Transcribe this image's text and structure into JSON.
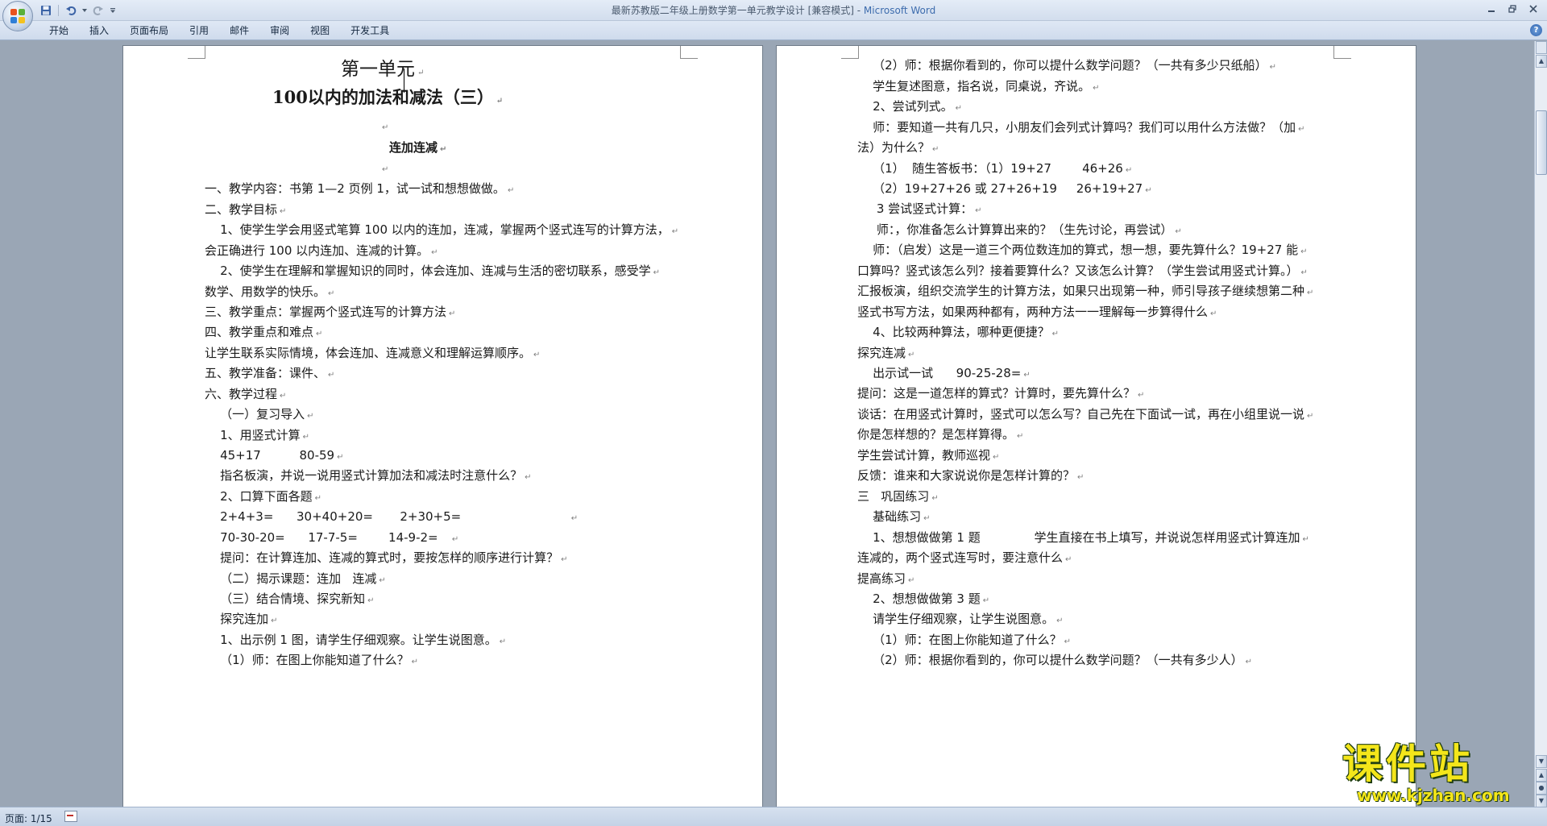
{
  "window": {
    "title": "最新苏教版二年级上册数学第一单元教学设计 [兼容模式] - ",
    "app_name": "Microsoft Word"
  },
  "ribbon": {
    "tabs": [
      "开始",
      "插入",
      "页面布局",
      "引用",
      "邮件",
      "审阅",
      "视图",
      "开发工具"
    ]
  },
  "icons": {
    "office_button": "office-logo-icon",
    "save": "save-icon",
    "undo": "undo-icon",
    "redo": "redo-icon",
    "customize": "qat-dropdown-icon",
    "minimize": "minimize-icon",
    "maximize": "restore-icon",
    "close": "close-icon",
    "help": "help-icon"
  },
  "colors": {
    "office_logo": [
      "#e8531f",
      "#5ab03a",
      "#2f7fd6",
      "#f4c21f"
    ],
    "watermark_fill": "#f4e61a",
    "watermark_outline": "#1f3d12"
  },
  "page_left": {
    "paragraphs": [
      "第一单元",
      "100以内的加法和减法（三）",
      "",
      "连加连减",
      "",
      "一、教学内容：书第 1—2 页例 1，试一试和想想做做。",
      "二、教学目标",
      "    1、使学生学会用竖式笔算 100 以内的连加，连减，掌握两个竖式连写的计算方法，",
      "会正确进行 100 以内连加、连减的计算。",
      "    2、使学生在理解和掌握知识的同时，体会连加、连减与生活的密切联系，感受学",
      "数学、用数学的快乐。",
      "三、教学重点：掌握两个竖式连写的计算方法",
      "四、教学重点和难点",
      "让学生联系实际情境，体会连加、连减意义和理解运算顺序。",
      "五、教学准备：课件、",
      "六、教学过程",
      "    （一）复习导入",
      "    1、用竖式计算",
      "    45+17          80-59",
      "    指名板演，并说一说用竖式计算加法和减法时注意什么？",
      "    2、口算下面各题",
      "    2+4+3=      30+40+20=       2+30+5=                            ",
      "    70-30-20=      17-7-5=        14-9-2=   ",
      "    提问：在计算连加、连减的算式时，要按怎样的顺序进行计算？",
      "    （二）揭示课题：连加   连减",
      "    （三）结合情境、探究新知",
      "    探究连加",
      "    1、出示例 1 图，请学生仔细观察。让学生说图意。",
      "    （1）师：在图上你能知道了什么？"
    ]
  },
  "page_right": {
    "paragraphs": [
      "    （2）师：根据你看到的，你可以提什么数学问题？（一共有多少只纸船）",
      "    学生复述图意，指名说，同桌说，齐说。",
      "    2、尝试列式。",
      "    师：要知道一共有几只，小朋友们会列式计算吗？我们可以用什么方法做？（加",
      "法）为什么？",
      "    （1）  随生答板书：（1）19+27        46+26",
      "    （2）19+27+26 或 27+26+19     26+19+27",
      "     3 尝试竖式计算：",
      "     师：，你准备怎么计算算出来的？（生先讨论，再尝试）",
      "    师：（启发）这是一道三个两位数连加的算式，想一想，要先算什么？19+27 能",
      "口算吗？竖式该怎么列？接着要算什么？又该怎么计算？（学生尝试用竖式计算。）",
      "汇报板演，组织交流学生的计算方法，如果只出现第一种，师引导孩子继续想第二种",
      "竖式书写方法，如果两种都有，两种方法一一理解每一步算得什么",
      "    4、比较两种算法，哪种更便捷？",
      "探究连减",
      "    出示试一试      90-25-28=",
      "提问：这是一道怎样的算式？计算时，要先算什么？",
      "谈话：在用竖式计算时，竖式可以怎么写？自己先在下面试一试，再在小组里说一说",
      "你是怎样想的？是怎样算得。",
      "学生尝试计算，教师巡视",
      "反馈：谁来和大家说说你是怎样计算的？",
      "三   巩固练习",
      "    基础练习",
      "    1、想想做做第 1 题              学生直接在书上填写，并说说怎样用竖式计算连加",
      "连减的，两个竖式连写时，要注意什么",
      "提高练习",
      "    2、想想做做第 3 题",
      "    请学生仔细观察，让学生说图意。",
      "    （1）师：在图上你能知道了什么？",
      "    （2）师：根据你看到的，你可以提什么数学问题？（一共有多少人）"
    ]
  },
  "statusbar": {
    "page_info": "页面: 1/15",
    "proofing_icon": "proofing-error-icon"
  },
  "watermark": {
    "chinese": "课件站",
    "url": "www.kjzhan.com"
  }
}
